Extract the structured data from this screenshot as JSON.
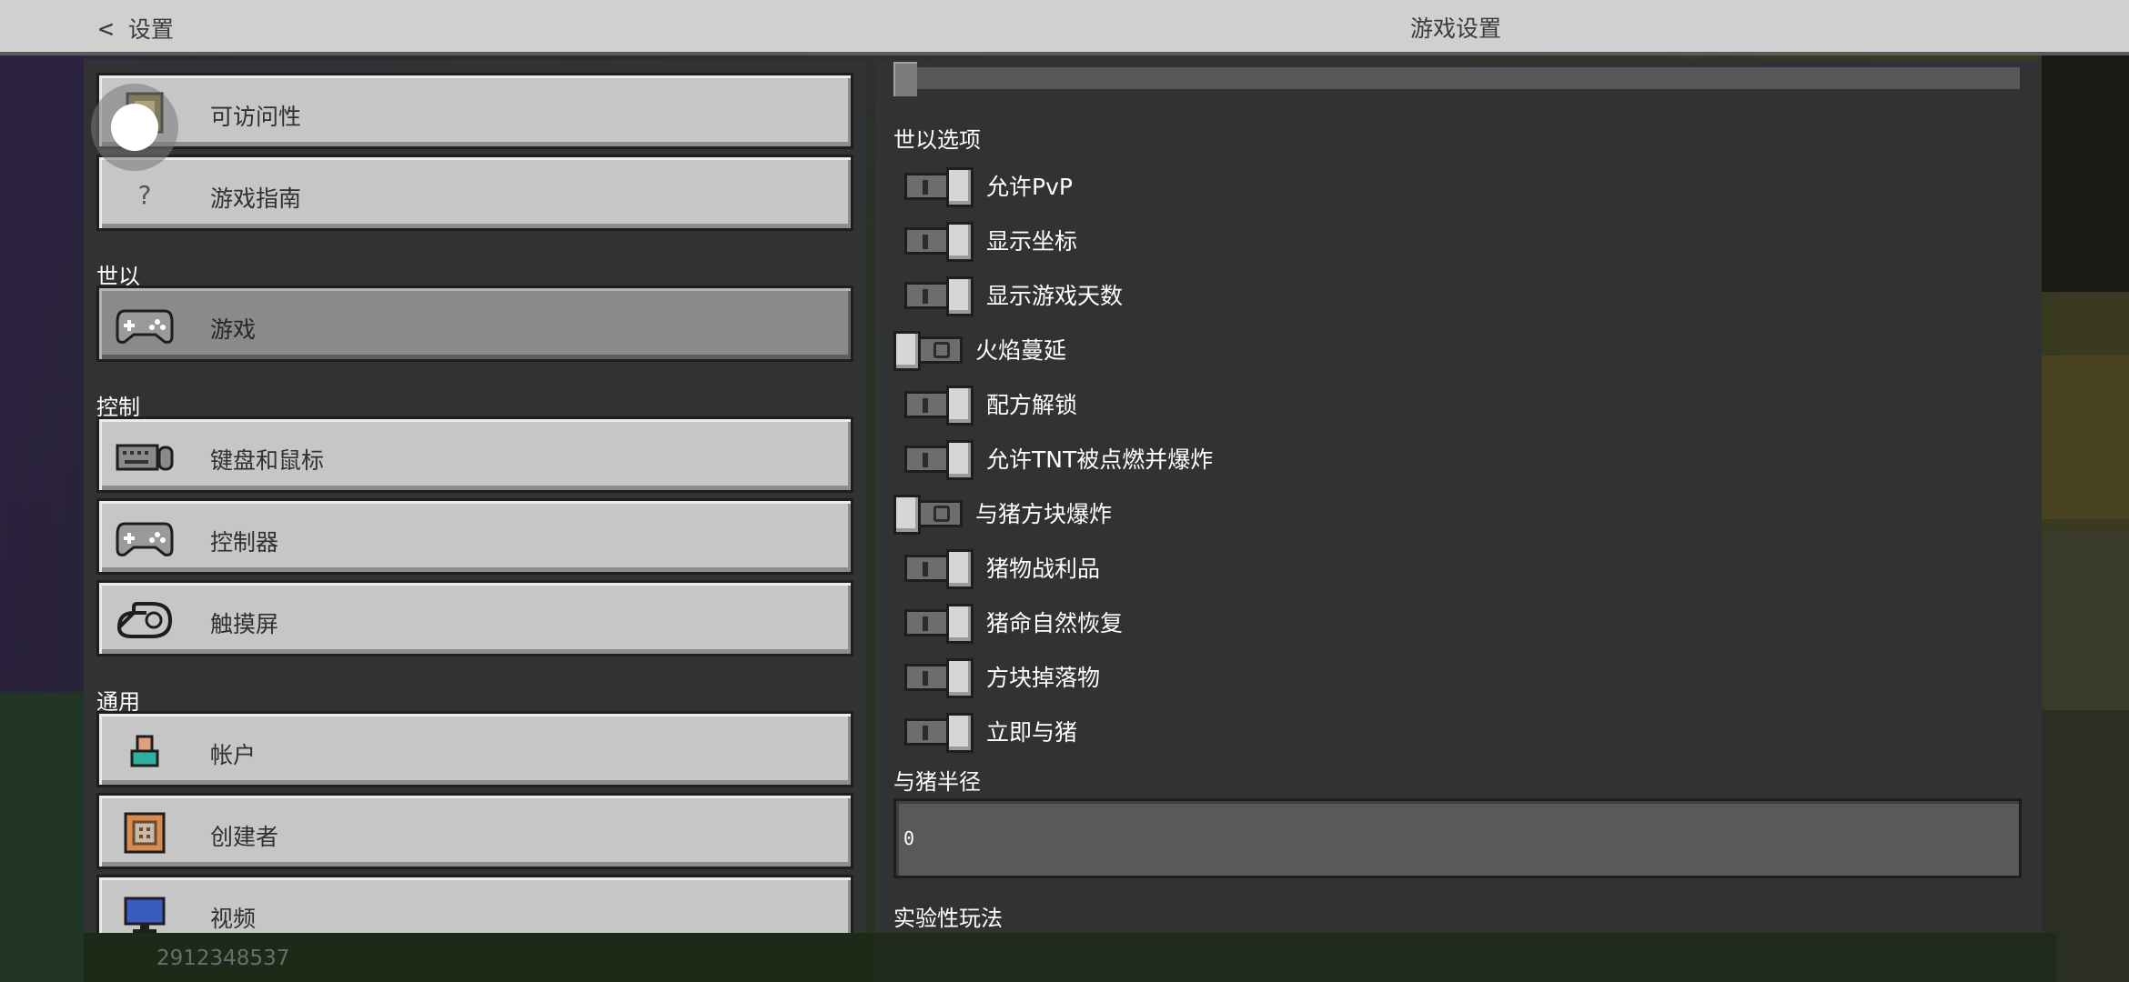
{
  "header": {
    "back_label": "设置",
    "title": "游戏设置"
  },
  "left_menu": {
    "top_items": [
      {
        "label": "可访问性",
        "icon": "accessibility-icon"
      },
      {
        "label": "游戏指南",
        "icon": "question-mark-icon",
        "glyph": "?"
      }
    ],
    "sections": [
      {
        "title": "世以",
        "items": [
          {
            "label": "游戏",
            "icon": "gamepad-icon",
            "active": true
          }
        ]
      },
      {
        "title": "控制",
        "items": [
          {
            "label": "键盘和鼠标",
            "icon": "keyboard-mouse-icon"
          },
          {
            "label": "控制器",
            "icon": "controller-icon"
          },
          {
            "label": "触摸屏",
            "icon": "touch-hand-icon"
          }
        ]
      },
      {
        "title": "通用",
        "items": [
          {
            "label": "帐户",
            "icon": "account-icon"
          },
          {
            "label": "创建者",
            "icon": "creator-icon"
          },
          {
            "label": "视频",
            "icon": "video-monitor-icon"
          }
        ]
      }
    ]
  },
  "right_panel": {
    "world_options_title": "世以选项",
    "toggles": [
      {
        "label": "允许PvP",
        "on": true
      },
      {
        "label": "显示坐标",
        "on": true
      },
      {
        "label": "显示游戏天数",
        "on": true
      },
      {
        "label": "火焰蔓延",
        "on": false
      },
      {
        "label": "配方解锁",
        "on": true
      },
      {
        "label": "允许TNT被点燃并爆炸",
        "on": true
      },
      {
        "label": "与猪方块爆炸",
        "on": false
      },
      {
        "label": "猪物战利品",
        "on": true
      },
      {
        "label": "猪命自然恢复",
        "on": true
      },
      {
        "label": "方块掉落物",
        "on": true
      },
      {
        "label": "立即与猪",
        "on": true
      }
    ],
    "radius_label": "与猪半径",
    "radius_value": "0",
    "experimental_title": "实验性玩法"
  },
  "seed_text": "2912348537",
  "colors": {
    "panel_bg": "#313233",
    "button_bg": "#c6c6c6",
    "button_active_bg": "#8a8a8c",
    "topbar_bg": "#d0d0d0"
  }
}
